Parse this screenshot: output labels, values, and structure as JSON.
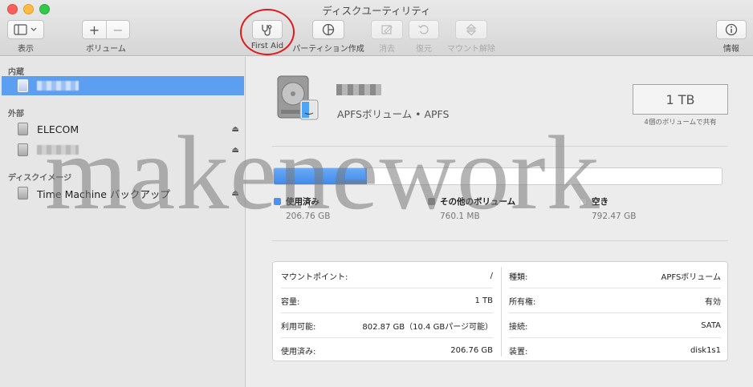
{
  "window": {
    "title": "ディスクユーティリティ"
  },
  "toolbar": {
    "view_label": "表示",
    "volume_label": "ボリューム",
    "volume_add": "+",
    "volume_remove": "−",
    "first_aid_label": "First Aid",
    "partition_label": "パーティション作成",
    "erase_label": "消去",
    "restore_label": "復元",
    "unmount_label": "マウント解除",
    "info_label": "情報"
  },
  "sidebar": {
    "sections": [
      {
        "header": "内蔵"
      },
      {
        "header": "外部"
      },
      {
        "header": "ディスクイメージ"
      }
    ],
    "items": [
      {
        "label": "",
        "selected": true
      },
      {
        "label": "ELECOM",
        "eject": "⏏"
      },
      {
        "label": "",
        "eject": "⏏"
      },
      {
        "label": "Time Machine バックアップ",
        "eject": "⏏"
      }
    ]
  },
  "volume": {
    "subtitle": "APFSボリューム • APFS",
    "capacity": "1 TB",
    "shared_note": "4個のボリュームで共有"
  },
  "usage": {
    "used_fraction": 0.207,
    "colors": {
      "used": "#3f8aed",
      "other": "#8a8a8a",
      "free": "#ffffff"
    },
    "legend": [
      {
        "label": "使用済み",
        "value": "206.76 GB"
      },
      {
        "label": "その他のボリューム",
        "value": "760.1 MB"
      },
      {
        "label": "空き",
        "value": "792.47 GB"
      }
    ]
  },
  "info": {
    "left": [
      {
        "key": "マウントポイント:",
        "value": "/"
      },
      {
        "key": "容量:",
        "value": "1 TB"
      },
      {
        "key": "利用可能:",
        "value": "802.87 GB（10.4 GBパージ可能）"
      },
      {
        "key": "使用済み:",
        "value": "206.76 GB"
      }
    ],
    "right": [
      {
        "key": "種類:",
        "value": "APFSボリューム"
      },
      {
        "key": "所有権:",
        "value": "有効"
      },
      {
        "key": "接続:",
        "value": "SATA"
      },
      {
        "key": "装置:",
        "value": "disk1s1"
      }
    ]
  },
  "watermark": "makenework"
}
